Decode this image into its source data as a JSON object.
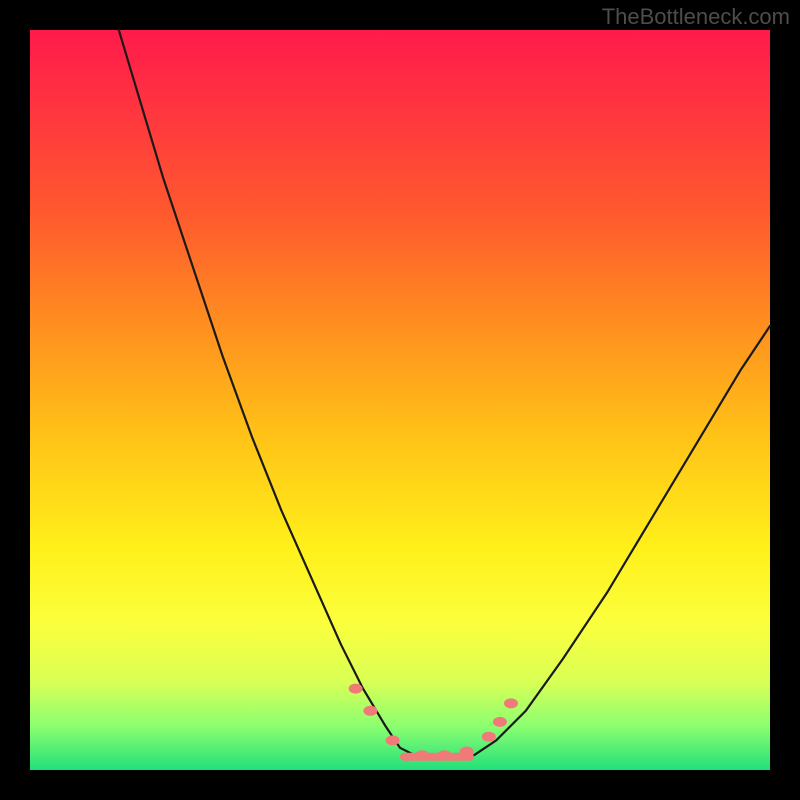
{
  "attribution": "TheBottleneck.com",
  "colors": {
    "gradient_top": "#ff1a4b",
    "gradient_upper": "#ff8f1f",
    "gradient_mid": "#fff01a",
    "gradient_bottom": "#22e07a",
    "curve": "#1a1a1a",
    "ticks": "#ef7a78",
    "frame": "#000000"
  },
  "chart_data": {
    "type": "line",
    "title": "",
    "xlabel": "",
    "ylabel": "",
    "xlim": [
      0,
      100
    ],
    "ylim": [
      0,
      100
    ],
    "grid": false,
    "note": "Values are read off the plotted curve in percent of axis length; x is horizontal, y is bottleneck percentage (0 at bottom/green, 100 at top/red). The curve is a V shape: steep left branch from off-chart top-left down to a flat minimum around x≈50–60, then rising again on the right.",
    "series": [
      {
        "name": "bottleneck-curve",
        "x": [
          12,
          15,
          18,
          22,
          26,
          30,
          34,
          38,
          42,
          45,
          48,
          50,
          52,
          55,
          58,
          60,
          63,
          67,
          72,
          78,
          84,
          90,
          96,
          100
        ],
        "y": [
          100,
          90,
          80,
          68,
          56,
          45,
          35,
          26,
          17,
          11,
          6,
          3,
          2,
          1.5,
          1.5,
          2,
          4,
          8,
          15,
          24,
          34,
          44,
          54,
          60
        ]
      }
    ],
    "tick_markers": {
      "note": "Salmon-colored marker pills near curve bottom",
      "points": [
        {
          "x": 44,
          "y": 11
        },
        {
          "x": 46,
          "y": 8
        },
        {
          "x": 49,
          "y": 4
        },
        {
          "x": 53,
          "y": 2
        },
        {
          "x": 56,
          "y": 2
        },
        {
          "x": 59,
          "y": 2.5
        },
        {
          "x": 62,
          "y": 4.5
        },
        {
          "x": 63.5,
          "y": 6.5
        },
        {
          "x": 65,
          "y": 9
        }
      ]
    }
  }
}
